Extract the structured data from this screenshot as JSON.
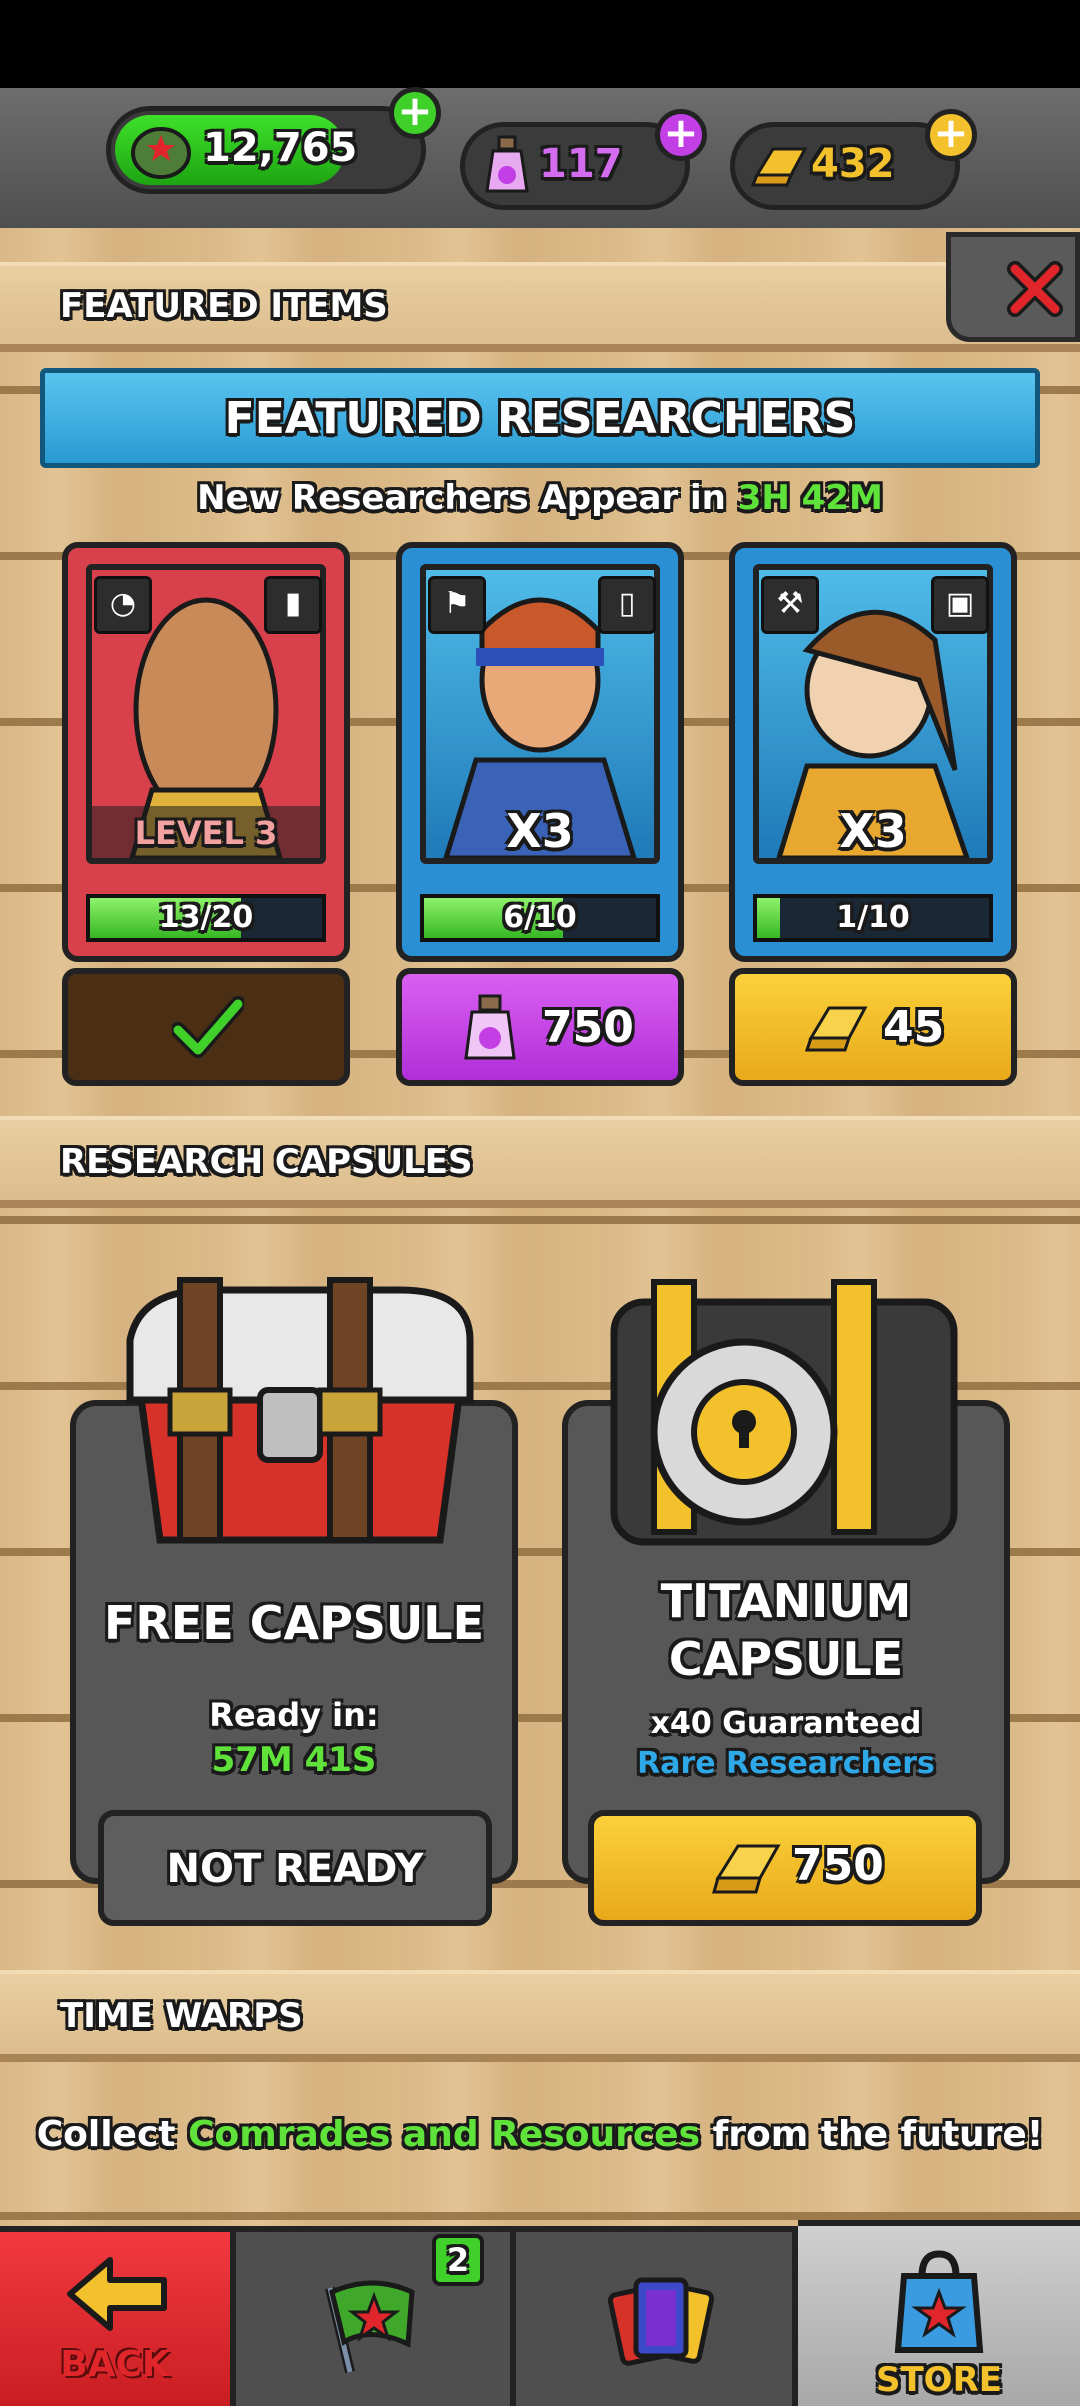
{
  "currency": {
    "soldiers": "12,765",
    "potions": "117",
    "gold": "432"
  },
  "sections": {
    "featured_items": "FEATURED ITEMS",
    "research_capsules": "RESEARCH CAPSULES",
    "time_warps": "TIME WARPS"
  },
  "featured": {
    "banner": "FEATURED RESEARCHERS",
    "timer_prefix": "New Researchers Appear in",
    "timer_value": "3H 42M",
    "cards": [
      {
        "overlay": "LEVEL 3",
        "progress": "13/20",
        "fraction": 0.65,
        "frame": "red",
        "action": "owned"
      },
      {
        "overlay": "X3",
        "progress": "6/10",
        "fraction": 0.6,
        "frame": "blue",
        "action": "potion",
        "price": "750"
      },
      {
        "overlay": "X3",
        "progress": "1/10",
        "fraction": 0.1,
        "frame": "blue",
        "action": "gold",
        "price": "45"
      }
    ]
  },
  "capsules": {
    "free": {
      "title": "FREE CAPSULE",
      "ready_label": "Ready in:",
      "ready_time": "57M 41S",
      "button": "NOT READY"
    },
    "titanium": {
      "title_line1": "TITANIUM",
      "title_line2": "CAPSULE",
      "guarantee": "x40 Guaranteed",
      "rarity": "Rare Researchers",
      "price": "750"
    }
  },
  "time_warps": {
    "text_start": "Collect",
    "text_highlight": "Comrades and Resources",
    "text_end": "from the future!"
  },
  "nav": {
    "back": "BACK",
    "missions_badge": "2",
    "store": "STORE"
  },
  "colors": {
    "green_accent": "#3fd12a",
    "purple": "#c23fe6",
    "gold": "#f3c12c",
    "blue_banner": "#3aaee6",
    "rare_blue": "#29a3e0",
    "back_red": "#e0262b"
  }
}
